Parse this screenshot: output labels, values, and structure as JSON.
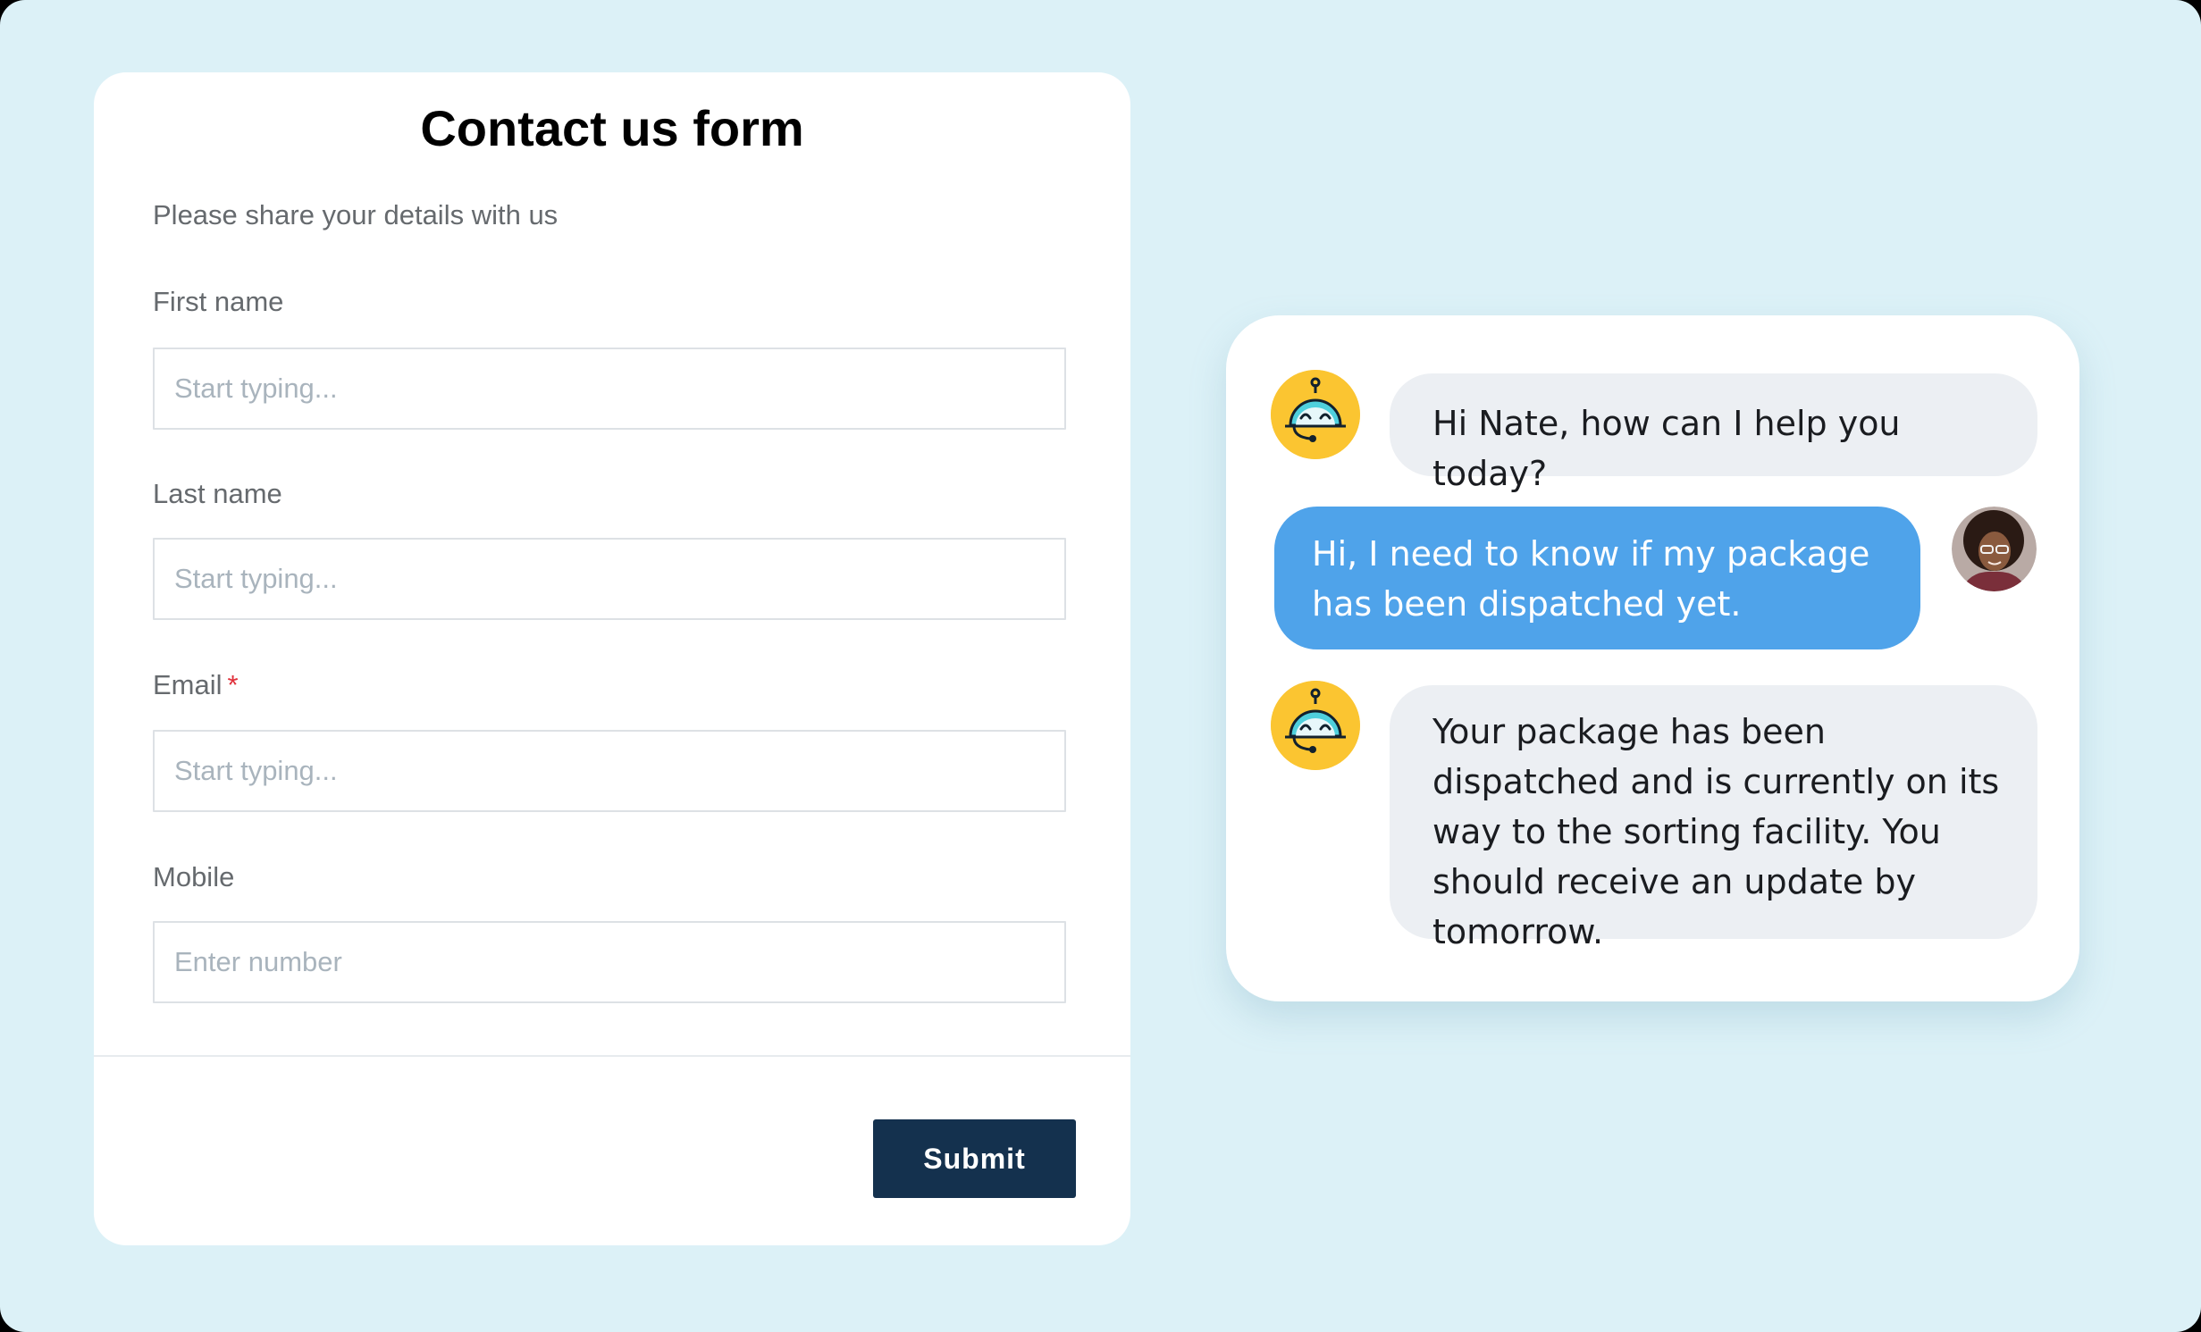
{
  "form": {
    "title": "Contact us form",
    "subtitle": "Please share your details with us",
    "fields": [
      {
        "label": "First name",
        "placeholder": "Start typing...",
        "required": false
      },
      {
        "label": "Last name",
        "placeholder": "Start typing...",
        "required": false
      },
      {
        "label": "Email",
        "placeholder": "Start typing...",
        "required": true,
        "required_mark": "*"
      },
      {
        "label": "Mobile",
        "placeholder": "Enter number",
        "required": false
      }
    ],
    "submit_label": "Submit"
  },
  "chat": {
    "messages": [
      {
        "sender": "bot",
        "text": "Hi Nate, how can I help you today?"
      },
      {
        "sender": "user",
        "text": "Hi, I need to know if my package has been dispatched yet."
      },
      {
        "sender": "bot",
        "text": "Your package has been dispatched and is currently on its way to the sorting facility. You should receive an update by tomorrow."
      }
    ]
  },
  "colors": {
    "page_background": "#dcf1f7",
    "submit_button": "#14314e",
    "user_bubble": "#4fa3ea",
    "bot_bubble": "#eceff3",
    "bot_avatar": "#fbc531",
    "required_mark": "#e0303a"
  },
  "icons": {
    "bot_avatar": "robot-support-icon",
    "user_avatar": "user-photo"
  }
}
